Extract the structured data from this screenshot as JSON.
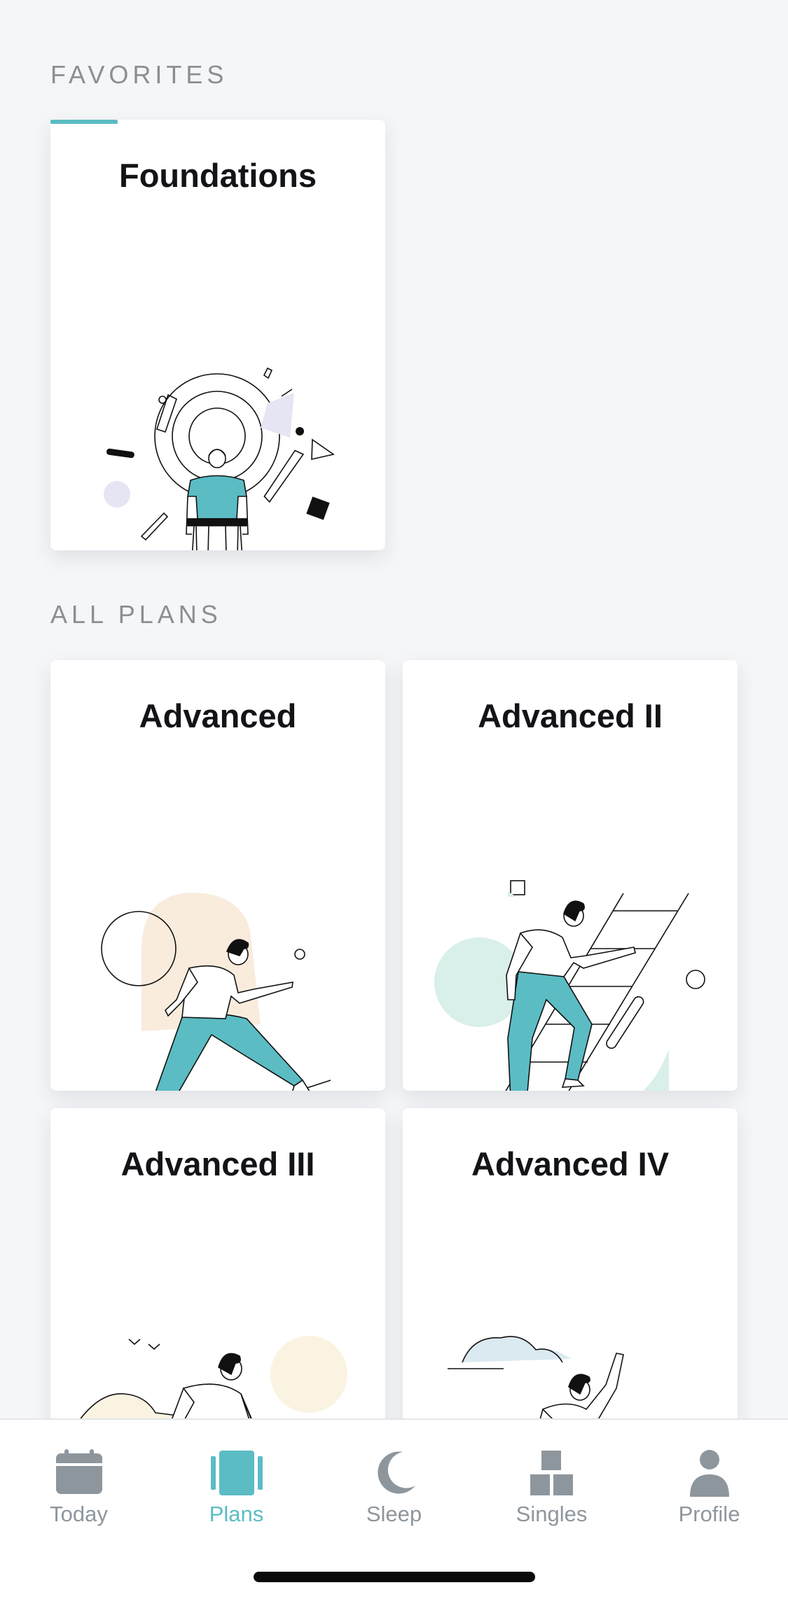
{
  "favorites": {
    "header": "FAVORITES",
    "cards": [
      {
        "title": "Foundations"
      }
    ]
  },
  "all_plans": {
    "header": "ALL PLANS",
    "cards": [
      {
        "title": "Advanced"
      },
      {
        "title": "Advanced II"
      },
      {
        "title": "Advanced III"
      },
      {
        "title": "Advanced IV"
      }
    ]
  },
  "tabbar": {
    "tabs": [
      {
        "label": "Today",
        "icon": "calendar-icon",
        "active": false
      },
      {
        "label": "Plans",
        "icon": "plans-cards-icon",
        "active": true
      },
      {
        "label": "Sleep",
        "icon": "moon-icon",
        "active": false
      },
      {
        "label": "Singles",
        "icon": "blocks-icon",
        "active": false
      },
      {
        "label": "Profile",
        "icon": "person-icon",
        "active": false
      }
    ]
  },
  "colors": {
    "accent": "#5bbcc4",
    "inactive": "#8e969d",
    "background": "#f5f6f8",
    "lavender": "#e6e5f4",
    "peach": "#f9ecdd",
    "mint": "#d9efea",
    "sand": "#fbf3e2",
    "sky": "#dbe9f0"
  }
}
